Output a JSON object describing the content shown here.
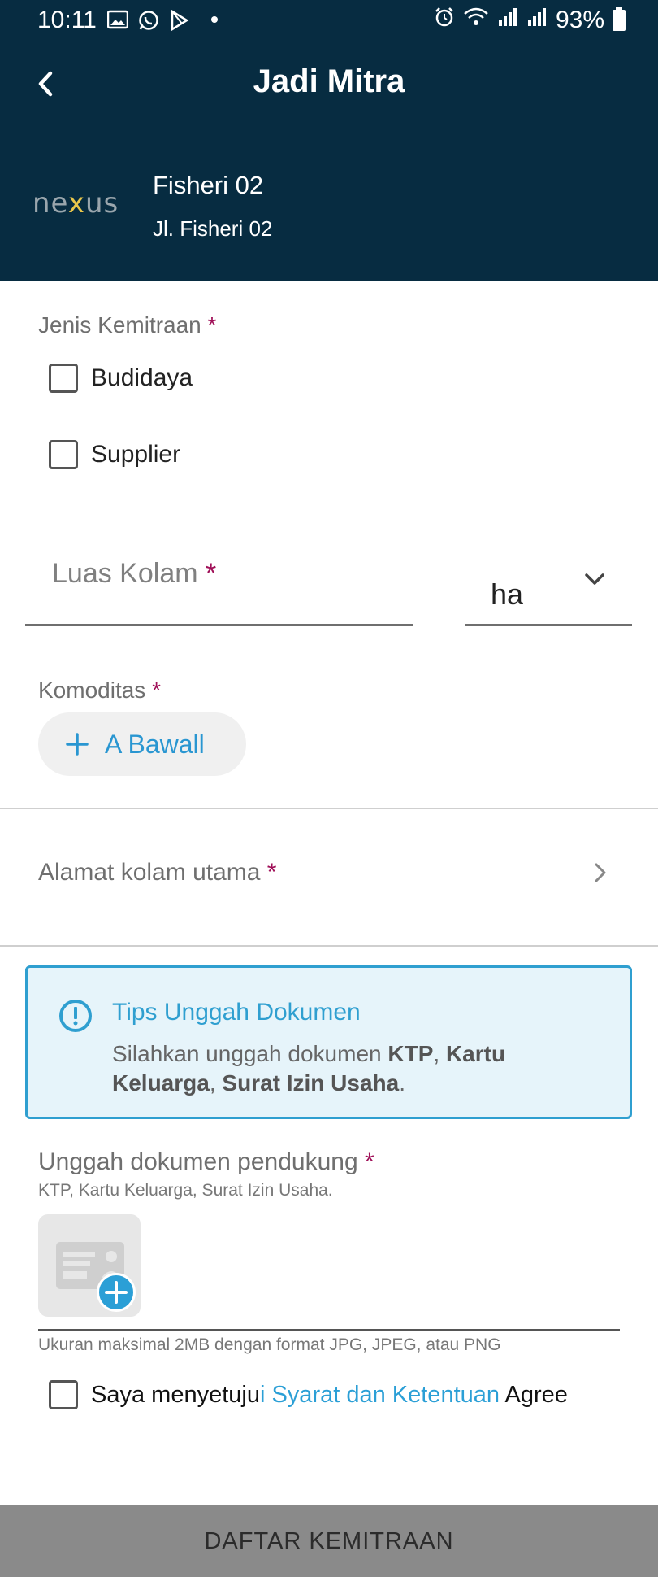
{
  "status_bar": {
    "time": "10:11",
    "battery": "93%",
    "icons_left": [
      "image-icon",
      "whatsapp-icon",
      "play-store-icon",
      "dot-icon"
    ],
    "icons_right": [
      "alarm-icon",
      "wifi-icon",
      "signal-icon",
      "signal-icon",
      "battery-icon"
    ]
  },
  "header": {
    "title": "Jadi Mitra",
    "logo_text": "nexus",
    "store_name": "Fisheri 02",
    "store_address": "Jl. Fisheri 02"
  },
  "form": {
    "required_mark": "*",
    "jenis": {
      "label": "Jenis Kemitraan",
      "options": [
        "Budidaya",
        "Supplier"
      ]
    },
    "luas": {
      "placeholder": "Luas Kolam",
      "unit": "ha"
    },
    "komoditas": {
      "label": "Komoditas",
      "chip": "A Bawall"
    },
    "alamat": {
      "label": "Alamat kolam utama"
    },
    "tips": {
      "title": "Tips Unggah Dokumen",
      "body_prefix": "Silahkan unggah dokumen ",
      "doc1": "KTP",
      "doc2": "Kartu Keluarga",
      "doc3": "Surat Izin Usaha",
      "sep": ", ",
      "end": "."
    },
    "upload": {
      "label": "Unggah dokumen pendukung",
      "sublabel": "KTP, Kartu Keluarga, Surat Izin Usaha.",
      "hint": "Ukuran maksimal 2MB dengan format JPG, JPEG, atau PNG"
    },
    "agree": {
      "prefix": "Saya menyetuju",
      "link": "i Syarat dan Ketentuan",
      "suffix": " Agree"
    },
    "submit": "DAFTAR KEMITRAAN"
  },
  "colors": {
    "header_bg": "#072c41",
    "accent": "#2b9fd6",
    "required": "#a01058",
    "tips_bg": "#e6f4fa",
    "submit_bg": "#8a8a8a"
  }
}
